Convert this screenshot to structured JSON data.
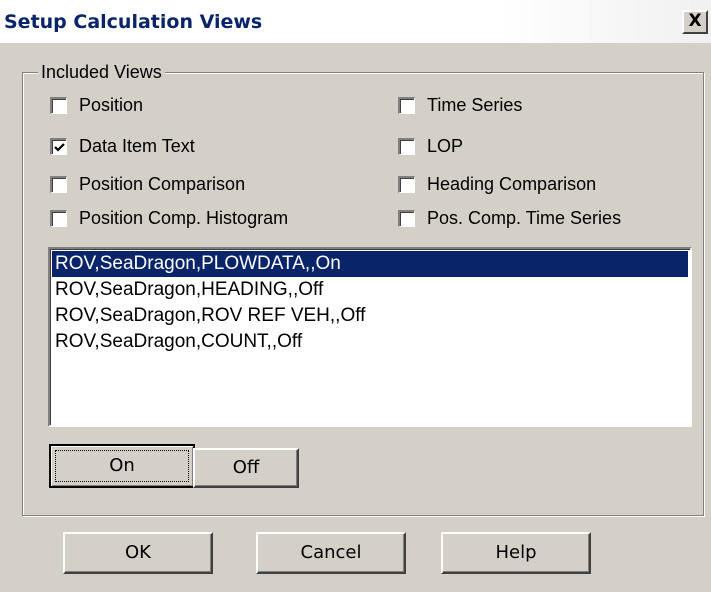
{
  "window": {
    "title": "Setup Calculation Views",
    "close_glyph": "X"
  },
  "included_views": {
    "legend": "Included Views",
    "checkboxes": [
      {
        "label": "Position",
        "checked": false
      },
      {
        "label": "Data Item Text",
        "checked": true
      },
      {
        "label": "Position Comparison",
        "checked": false
      },
      {
        "label": "Position Comp. Histogram",
        "checked": false
      },
      {
        "label": "Time Series",
        "checked": false
      },
      {
        "label": "LOP",
        "checked": false
      },
      {
        "label": "Heading Comparison",
        "checked": false
      },
      {
        "label": "Pos. Comp. Time Series",
        "checked": false
      }
    ],
    "list_items": [
      {
        "text": "ROV,SeaDragon,PLOWDATA,,On",
        "selected": true
      },
      {
        "text": "ROV,SeaDragon,HEADING,,Off",
        "selected": false
      },
      {
        "text": "ROV,SeaDragon,ROV REF VEH,,Off",
        "selected": false
      },
      {
        "text": "ROV,SeaDragon,COUNT,,Off",
        "selected": false
      }
    ],
    "on_label": "On",
    "off_label": "Off"
  },
  "footer": {
    "ok_label": "OK",
    "cancel_label": "Cancel",
    "help_label": "Help"
  },
  "colors": {
    "face": "#d4d0c8",
    "selection": "#0a246a",
    "title_text": "#0a246a"
  }
}
